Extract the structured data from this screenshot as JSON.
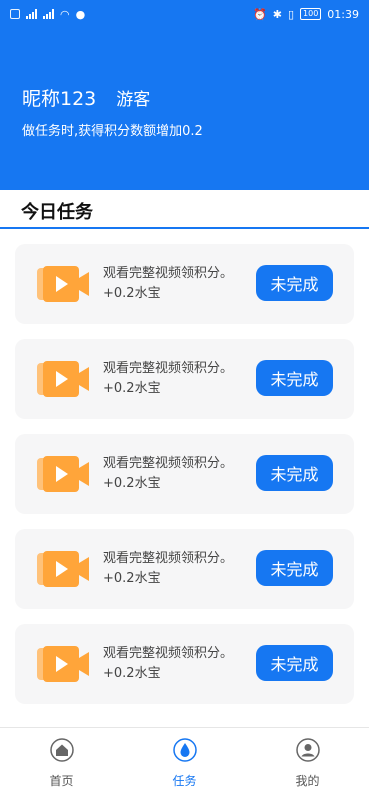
{
  "status_bar": {
    "time": "01:39",
    "battery": "100"
  },
  "header": {
    "nickname": "昵称123",
    "user_type": "游客",
    "bonus_note": "做任务时,获得积分数额增加0.2"
  },
  "section": {
    "title": "今日任务"
  },
  "tasks": [
    {
      "title": "观看完整视频领积分。",
      "reward": "+0.2水宝",
      "status": "未完成"
    },
    {
      "title": "观看完整视频领积分。",
      "reward": "+0.2水宝",
      "status": "未完成"
    },
    {
      "title": "观看完整视频领积分。",
      "reward": "+0.2水宝",
      "status": "未完成"
    },
    {
      "title": "观看完整视频领积分。",
      "reward": "+0.2水宝",
      "status": "未完成"
    },
    {
      "title": "观看完整视频领积分。",
      "reward": "+0.2水宝",
      "status": "未完成"
    }
  ],
  "bottom_nav": [
    {
      "label": "首页",
      "icon": "home-icon",
      "active": false
    },
    {
      "label": "任务",
      "icon": "water-drop-icon",
      "active": true
    },
    {
      "label": "我的",
      "icon": "user-icon",
      "active": false
    }
  ],
  "colors": {
    "primary": "#1677f2",
    "icon_orange": "#ffa53a",
    "card_bg": "#f6f6f7"
  }
}
